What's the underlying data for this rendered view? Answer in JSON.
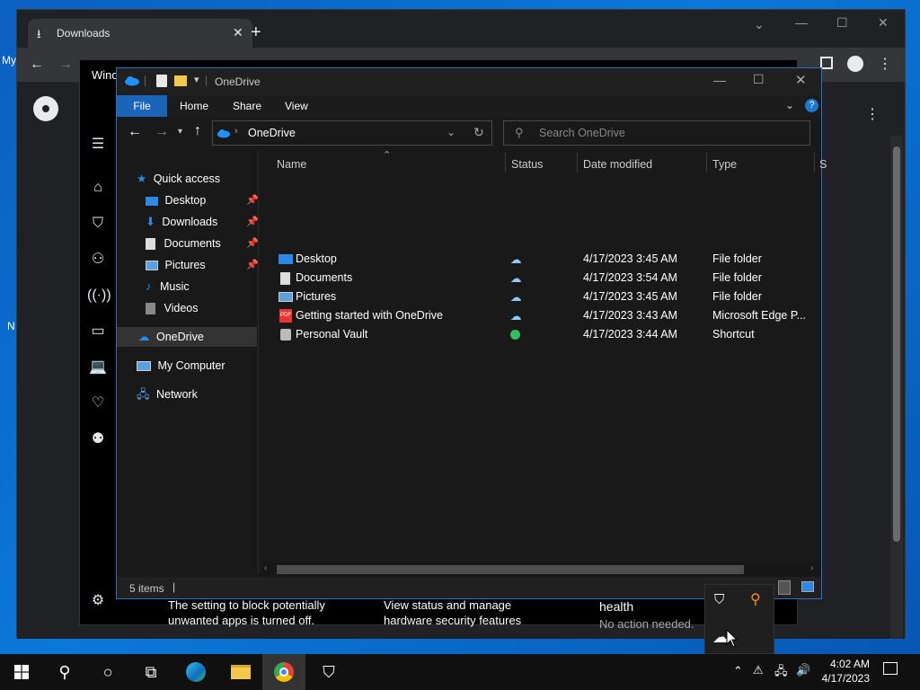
{
  "desktop": {
    "icon_labels": [
      "My",
      "N"
    ]
  },
  "chrome": {
    "tab_title": "Downloads",
    "new_tab": "+",
    "menu_dots": "⋮"
  },
  "windows_security": {
    "title": "Wind",
    "card1_text": "The setting to block potentially unwanted apps is turned off.",
    "card2_text": "View status and manage hardware security features",
    "card3_title": "health",
    "card3_text": "No action needed."
  },
  "explorer": {
    "title": "OneDrive",
    "ribbon_tabs": [
      "File",
      "Home",
      "Share",
      "View"
    ],
    "address": "OneDrive",
    "search_placeholder": "Search OneDrive",
    "nav": {
      "quick_access": "Quick access",
      "items": [
        {
          "label": "Desktop",
          "pinned": true,
          "icon": "desktop-folder-icon"
        },
        {
          "label": "Downloads",
          "pinned": true,
          "icon": "downloads-folder-icon"
        },
        {
          "label": "Documents",
          "pinned": true,
          "icon": "documents-folder-icon"
        },
        {
          "label": "Pictures",
          "pinned": true,
          "icon": "pictures-folder-icon"
        },
        {
          "label": "Music",
          "pinned": false,
          "icon": "music-folder-icon"
        },
        {
          "label": "Videos",
          "pinned": false,
          "icon": "videos-folder-icon"
        }
      ],
      "onedrive": "OneDrive",
      "my_computer": "My Computer",
      "network": "Network"
    },
    "columns": {
      "name": "Name",
      "status": "Status",
      "date": "Date modified",
      "type": "Type",
      "size_partial": "S"
    },
    "files": [
      {
        "name": "Desktop",
        "status": "cloud",
        "date": "4/17/2023 3:45 AM",
        "type": "File folder",
        "icon": "desktop-folder-icon"
      },
      {
        "name": "Documents",
        "status": "cloud",
        "date": "4/17/2023 3:54 AM",
        "type": "File folder",
        "icon": "documents-folder-icon"
      },
      {
        "name": "Pictures",
        "status": "cloud",
        "date": "4/17/2023 3:45 AM",
        "type": "File folder",
        "icon": "pictures-folder-icon"
      },
      {
        "name": "Getting started with OneDrive",
        "status": "cloud",
        "date": "4/17/2023 3:43 AM",
        "type": "Microsoft Edge P...",
        "icon": "pdf-icon"
      },
      {
        "name": "Personal Vault",
        "status": "synced",
        "date": "4/17/2023 3:44 AM",
        "type": "Shortcut",
        "icon": "vault-icon"
      }
    ],
    "status_text": "5 items"
  },
  "taskbar": {
    "time": "4:02 AM",
    "date": "4/17/2023"
  },
  "colors": {
    "accent": "#1a65b8",
    "onedrive_blue": "#1e90ff",
    "synced_green": "#2fbf5b",
    "folder_yellow": "#f2c94c"
  }
}
